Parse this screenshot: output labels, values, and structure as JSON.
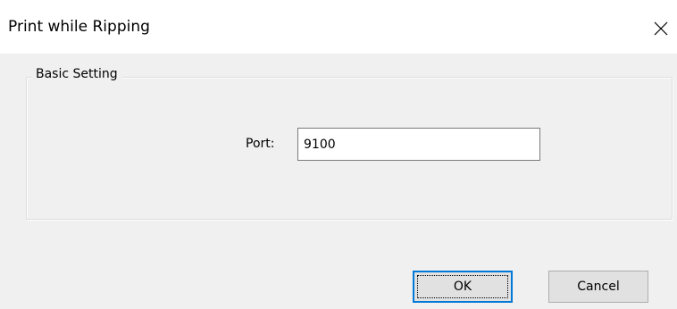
{
  "dialog": {
    "title": "Print while Ripping",
    "close_icon": "close-icon"
  },
  "group": {
    "legend": "Basic Setting"
  },
  "port": {
    "label": "Port:",
    "value": "9100"
  },
  "buttons": {
    "ok_label": "OK",
    "cancel_label": "Cancel"
  },
  "colors": {
    "dialog_background": "#f0f0f0",
    "title_background": "#ffffff",
    "button_background": "#e1e1e1",
    "default_button_border": "#0078d7"
  }
}
